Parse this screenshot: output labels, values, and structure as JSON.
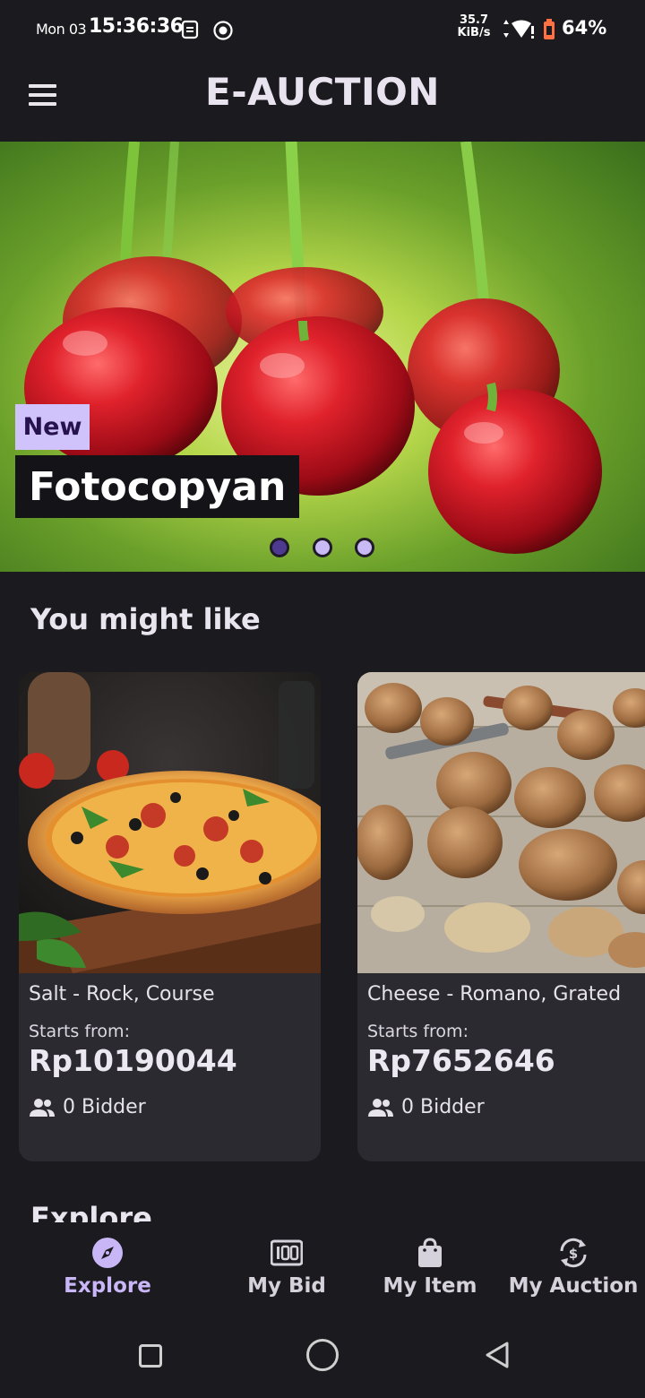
{
  "status_bar": {
    "day": "Mon 03",
    "time": "15:36:36",
    "speed_value": "35.7",
    "speed_unit": "KiB/s",
    "battery": "64%"
  },
  "app_bar": {
    "title": "E-AUCTION",
    "menu_icon": "hamburger-menu-icon"
  },
  "hero": {
    "badge": "New",
    "title": "Fotocopyan",
    "slide_count": 3,
    "active_slide": 0
  },
  "recommend": {
    "title": "You might like",
    "items": [
      {
        "name": "Salt - Rock, Course",
        "starts_label": "Starts from:",
        "price": "Rp10190044",
        "bidders": "0 Bidder"
      },
      {
        "name": "Cheese - Romano, Grated",
        "starts_label": "Starts from:",
        "price": "Rp7652646",
        "bidders": "0 Bidder"
      }
    ]
  },
  "explore": {
    "title": "Explore"
  },
  "bottom_nav": {
    "items": [
      {
        "label": "Explore",
        "icon": "compass-icon",
        "active": true
      },
      {
        "label": "My Bid",
        "icon": "bid-counter-icon",
        "active": false
      },
      {
        "label": "My Item",
        "icon": "shopping-bag-icon",
        "active": false
      },
      {
        "label": "My Auction",
        "icon": "currency-exchange-icon",
        "active": false
      }
    ]
  },
  "colors": {
    "background": "#1b1a1f",
    "card": "#2b2a31",
    "accent": "#c8b6f7",
    "badge": "#d0c2fb"
  }
}
